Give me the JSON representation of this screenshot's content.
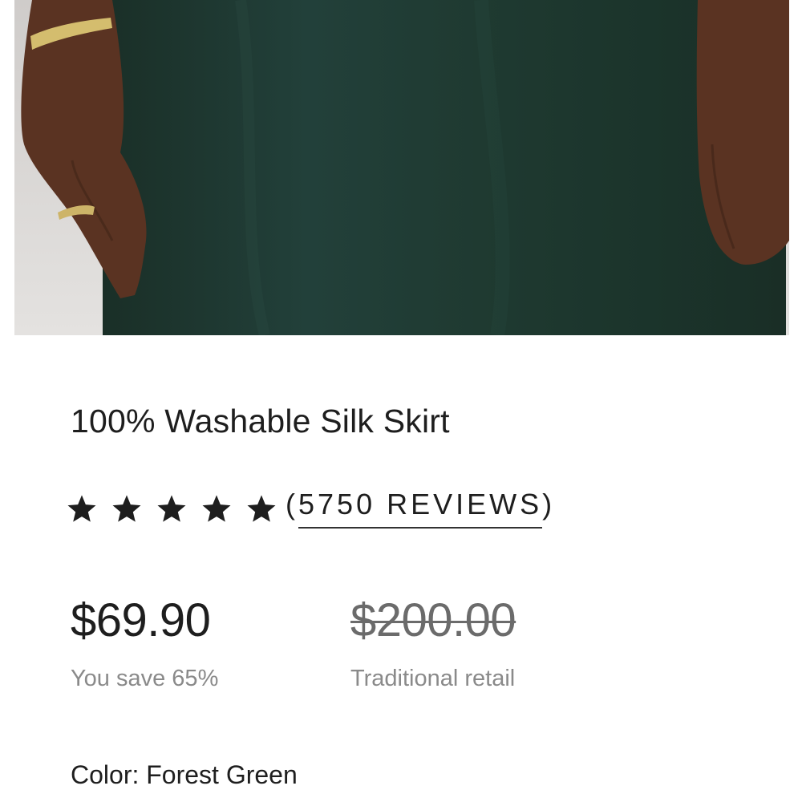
{
  "product": {
    "image_alt": "Model wearing forest green silk skirt",
    "title": "100% Washable Silk Skirt",
    "rating": {
      "stars": 5,
      "reviews_label": "(5750 REVIEWS)",
      "open_paren": "(",
      "count_text": "5750 REVIEWS",
      "close_paren": ")"
    },
    "price": {
      "sale": "$69.90",
      "sale_note": "You save 65%",
      "retail": "$200.00",
      "retail_note": "Traditional retail"
    },
    "color_label": "Color: Forest Green"
  },
  "colors": {
    "skirt": "#1f3a30",
    "skin": "#5a3322",
    "background": "#ffffff",
    "wall": "#d9d6d3",
    "gold": "#c8b061"
  },
  "icons": {
    "star": "star-icon"
  }
}
